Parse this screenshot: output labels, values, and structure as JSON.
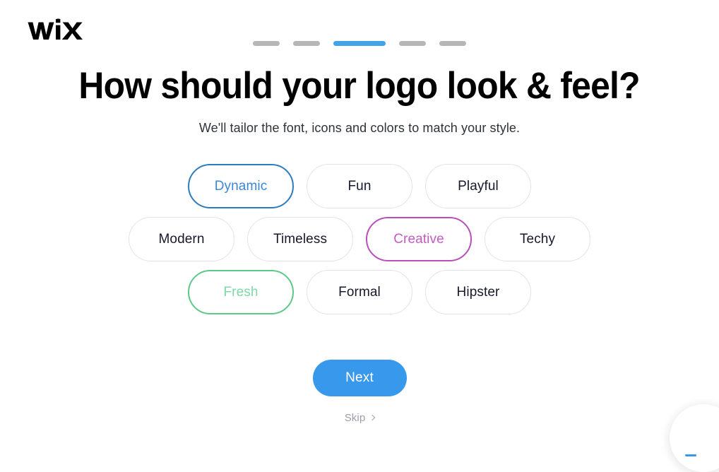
{
  "brand": {
    "logo_text": "WiX",
    "logo_icon": "wix-logo"
  },
  "progress": {
    "total_steps": 5,
    "active_step": 3,
    "steps": [
      {
        "state": "inactive"
      },
      {
        "state": "inactive"
      },
      {
        "state": "active"
      },
      {
        "state": "inactive"
      },
      {
        "state": "inactive"
      }
    ]
  },
  "main": {
    "title": "How should your logo look & feel?",
    "subtitle": "We'll tailor the font, icons and colors to match your style."
  },
  "chips": {
    "rows": [
      [
        {
          "label": "Dynamic",
          "selected": true,
          "accent": "blue"
        },
        {
          "label": "Fun",
          "selected": false,
          "accent": "none"
        },
        {
          "label": "Playful",
          "selected": false,
          "accent": "none"
        }
      ],
      [
        {
          "label": "Modern",
          "selected": false,
          "accent": "none"
        },
        {
          "label": "Timeless",
          "selected": false,
          "accent": "none"
        },
        {
          "label": "Creative",
          "selected": true,
          "accent": "purple"
        },
        {
          "label": "Techy",
          "selected": false,
          "accent": "none"
        }
      ],
      [
        {
          "label": "Fresh",
          "selected": true,
          "accent": "green"
        },
        {
          "label": "Formal",
          "selected": false,
          "accent": "none"
        },
        {
          "label": "Hipster",
          "selected": false,
          "accent": "none"
        }
      ]
    ]
  },
  "actions": {
    "next_label": "Next",
    "skip_label": "Skip",
    "skip_icon": "chevron-right-icon"
  },
  "help_widget": {
    "icon": "chat-help-icon"
  },
  "colors": {
    "accent_blue": "#3899ec",
    "progress_active": "#41a3e8",
    "progress_inactive": "#b6b6b6",
    "selected_blue": "#3b87d6",
    "selected_purple": "#c45ac4",
    "selected_green": "#7fd8a5",
    "chip_border": "#e3e3e3",
    "text_primary": "#16192b",
    "text_muted": "#9aa0a8",
    "background": "#ffffff"
  }
}
